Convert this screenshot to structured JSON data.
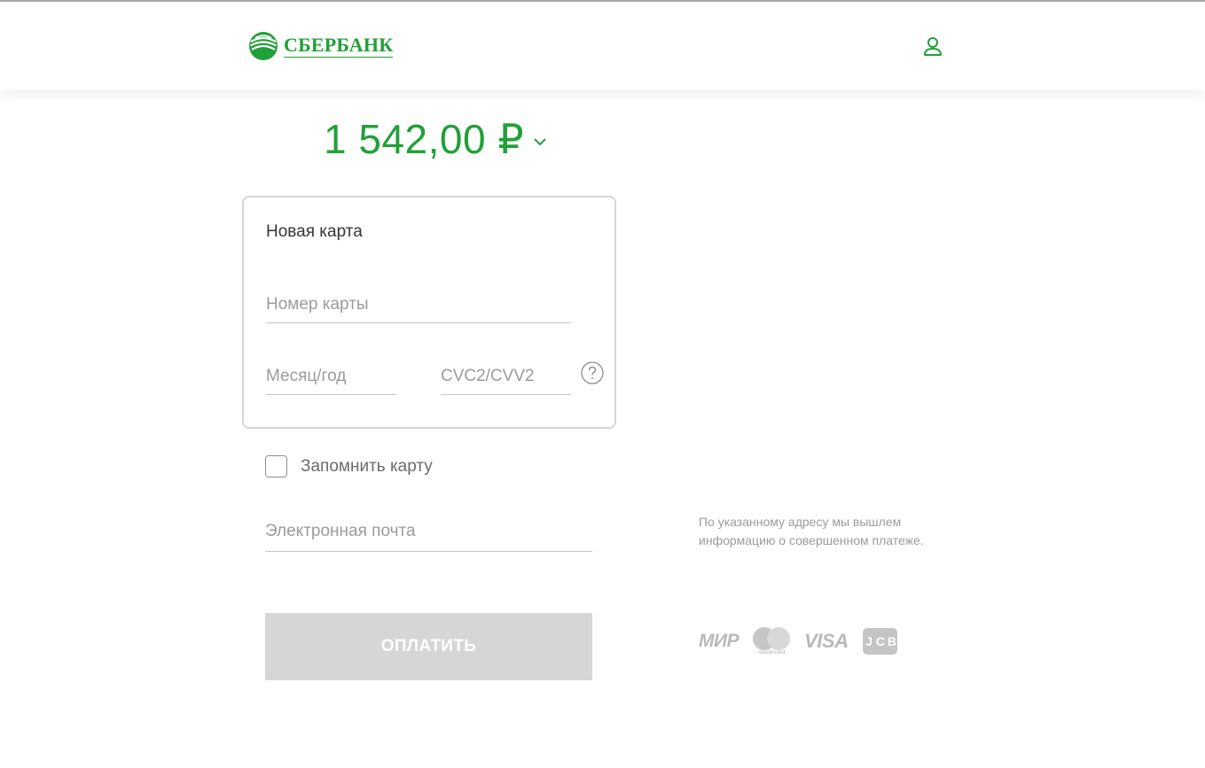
{
  "header": {
    "brand_name": "СБЕРБАНК",
    "logo_icon": "sberbank-logo-icon",
    "user_icon": "user-icon"
  },
  "payment": {
    "amount": "1 542,00 ₽",
    "amount_chevron_icon": "chevron-down-icon"
  },
  "card_form": {
    "title": "Новая карта",
    "card_number_placeholder": "Номер карты",
    "card_number_value": "",
    "expiry_placeholder": "Месяц/год",
    "expiry_value": "",
    "cvc_placeholder": "CVC2/CVV2",
    "cvc_value": "",
    "help_icon": "question-icon"
  },
  "remember_card": {
    "label": "Запомнить карту",
    "checked": false
  },
  "email": {
    "placeholder": "Электронная почта",
    "value": "",
    "note": "По указанному адресу мы вышлем информацию о совершенном платеже."
  },
  "pay_button": {
    "label": "ОПЛАТИТЬ"
  },
  "payment_systems": {
    "mir": "МИР",
    "mastercard": "mastercard",
    "visa": "VISA",
    "jcb": [
      "J",
      "C",
      "B"
    ]
  },
  "colors": {
    "accent": "#21a038",
    "button_disabled": "#d6d6d6",
    "border": "#d6d6d6",
    "muted_text": "#9b9b9b"
  }
}
